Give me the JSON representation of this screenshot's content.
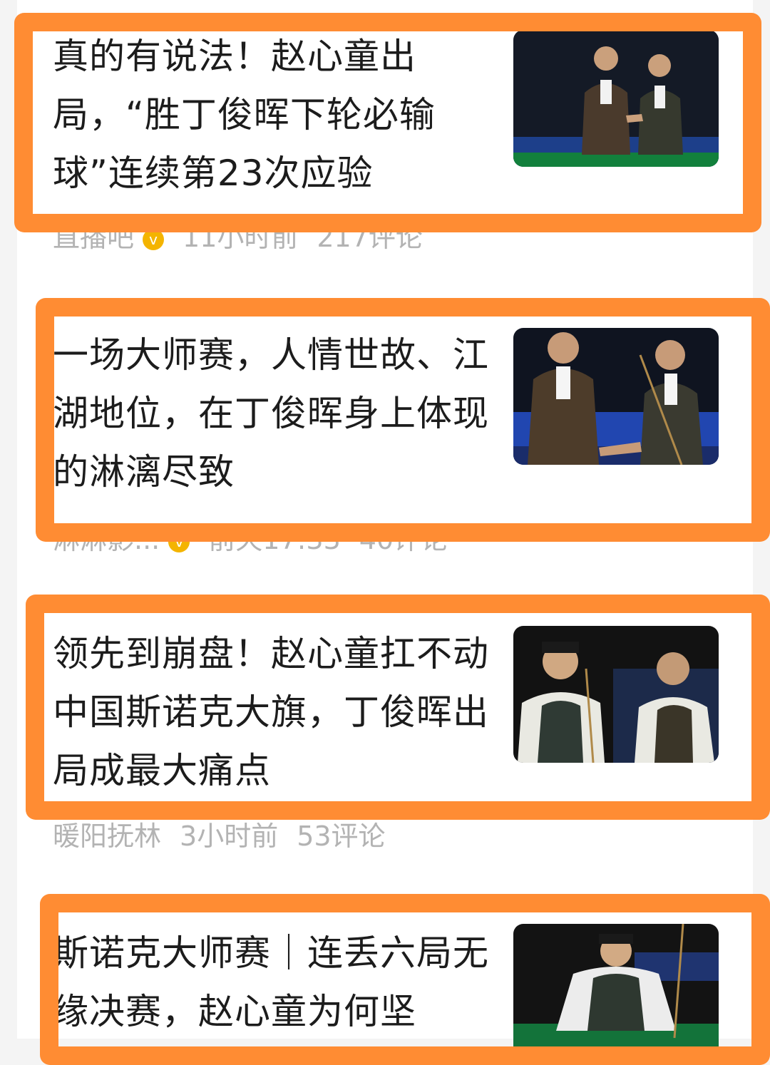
{
  "feed": {
    "items": [
      {
        "title": "真的有说法！赵心童出局，“胜丁俊晖下轮必输球”连续第23次应验",
        "source": "直播吧",
        "time": "11小时前",
        "comments": "217评论",
        "thumbnail_icon": "snooker-handshake-photo"
      },
      {
        "title": "一场大师赛，人情世故、江湖地位，在丁俊晖身上体现的淋漓尽致",
        "source": "淋淋影...",
        "time": "前天17:33",
        "comments": "40评论",
        "thumbnail_icon": "snooker-handshake-photo"
      },
      {
        "title": "领先到崩盘！赵心童扛不动中国斯诺克大旗，丁俊晖出局成最大痛点",
        "source": "暖阳抚林",
        "time": "3小时前",
        "comments": "53评论",
        "thumbnail_icon": "snooker-players-photo"
      },
      {
        "title": "斯诺克大师赛｜连丢六局无缘决赛，赵心童为何坚",
        "thumbnail_icon": "snooker-player-at-table-photo"
      }
    ]
  },
  "colors": {
    "highlight": "#ff8c33",
    "meta_text": "#b3b3b3",
    "title_text": "#1c1c1c",
    "verified_badge": "#f4b400"
  }
}
